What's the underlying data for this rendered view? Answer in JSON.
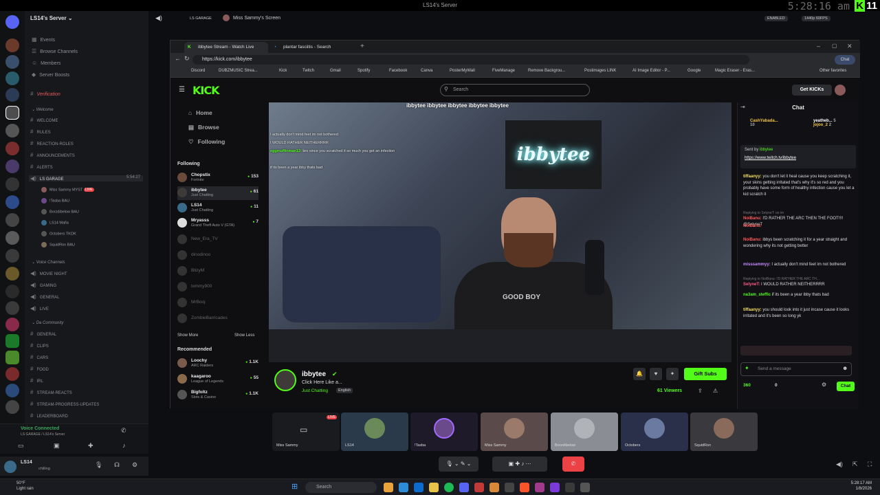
{
  "os": {
    "title": "LS14's Server",
    "clock_overlay": "5:28:16 am",
    "k_badge": "K",
    "k_number": "11",
    "enabled": "ENABLED",
    "resolution": "1440p 60FPS"
  },
  "discord": {
    "server_name": "LS14's Server",
    "menu": [
      "Events",
      "Browse Channels",
      "Members",
      "Server Boosts"
    ],
    "verification": "Verification",
    "welcome_category": "Welcome",
    "text_channels": [
      "WELCOME",
      "RULES",
      "REACTION-ROLES",
      "ANNOUNCEMENTS",
      "ALERTS"
    ],
    "garage_channel": "LS GARAGE",
    "garage_time": "5:54:27",
    "garage_members": [
      {
        "name": "Miss Sammy",
        "tag": "MYST",
        "live": "LIVE"
      },
      {
        "name": "!Tasba",
        "tag": "BAU"
      },
      {
        "name": "Borzdibelow",
        "tag": "BAU"
      },
      {
        "name": "LS14",
        "tag": "Mafia"
      },
      {
        "name": "Octobers",
        "tag": "TKOK"
      },
      {
        "name": "SquidRon",
        "tag": "BAU"
      }
    ],
    "voice_category": "Voice Channels",
    "voice_channels": [
      "MOVIE NIGHT",
      "GAMING",
      "GENERAL",
      "LIVE"
    ],
    "community_category": "Da Community",
    "community_channels": [
      "GENERAL",
      "CLIPS",
      "CARS",
      "FOOD",
      "IRL",
      "STREAM-REACTS",
      "STREAM-PROGRESS-UPDATES",
      "LEADERBOARD"
    ],
    "voice_connected": "Voice Connected",
    "voice_location": "LS GARAGE / LS14's Server",
    "user_name": "LS14",
    "user_status": "chilling",
    "stream_header": {
      "channel": "LS GARAGE",
      "screen_label": "Miss Sammy's Screen"
    }
  },
  "browser": {
    "tabs": [
      "ibbytee Stream - Watch Live",
      "plantar fasciitis - Search"
    ],
    "url": "https://kick.com/ibbytee",
    "bookmarks": [
      "Discord",
      "DUBZMUSIC Strea...",
      "Kick",
      "Twitch",
      "Gmail",
      "Spotify",
      "Facebook",
      "Canva",
      "PosterMyWall",
      "FiveManage",
      "Remove Backgrou...",
      "Postimages LINK",
      "AI Image Editor - P...",
      "Google",
      "Magic Eraser - Eras..."
    ],
    "other_bookmarks": "Other favorites",
    "chat_button": "Chat"
  },
  "kick": {
    "search_placeholder": "Search",
    "get_kicks": "Get KICKs",
    "nav": [
      "Home",
      "Browse",
      "Following"
    ],
    "following_label": "Following",
    "following": [
      {
        "name": "Chopstix",
        "game": "Fortnite",
        "count": "153"
      },
      {
        "name": "ibbytee",
        "game": "Just Chatting",
        "count": "61"
      },
      {
        "name": "LS14",
        "game": "Just Chatting",
        "count": "11"
      },
      {
        "name": "Mryasss",
        "game": "Grand Theft Auto V (GTA)",
        "count": "7"
      }
    ],
    "offline": [
      "New_Era_TV",
      "dinodinoo",
      "BlizyM",
      "tommy900",
      "MrBooj",
      "ZombieBarricades"
    ],
    "show_more": "Show More",
    "show_less": "Show Less",
    "recommended_label": "Recommended",
    "recommended": [
      {
        "name": "Loochy",
        "game": "ARC Raiders",
        "count": "1.1K"
      },
      {
        "name": "kaagaroo",
        "game": "League of Legends",
        "count": "55"
      },
      {
        "name": "Bigfoltz",
        "game": "Slots & Casino",
        "count": "1.1K"
      }
    ],
    "stream": {
      "socials": "ibbytee ibbytee ibbytee ibbytee ibbytee",
      "neon": "ibbytee",
      "shirt": "GOOD BOY",
      "overlay_chat": [
        {
          "user": "",
          "text": "I actually don't mind feet im not bothered"
        },
        {
          "user": "",
          "text": "I WOULD RATHER NEITHERRRR"
        },
        {
          "user": "eggmuffinman12:",
          "text": "bro since you scratched it so much you got an infection"
        },
        {
          "user": "",
          "text": "if its been a year ibby thats bad"
        }
      ],
      "name": "ibbytee",
      "title": "Click Here Like a...",
      "category": "Just Chatting",
      "language": "English",
      "gift_subs": "Gift Subs",
      "viewers": "61 Viewers"
    },
    "chat": {
      "title": "Chat",
      "top_gifters": [
        {
          "name": "CashYabada...",
          "count": "10"
        },
        {
          "name": "yeatheb...",
          "count": "5"
        },
        {
          "name": "jojoo_2",
          "count": "2"
        }
      ],
      "pinned_by": "Sent by",
      "pinned_user": "ibbytee",
      "pinned_link": "https://www.twitch.tv/ibbytee",
      "messages": [
        {
          "reply": "",
          "user": "tiffaanyy:",
          "color": "#f5e05a",
          "text": "you don't let it heal cause you keep scratching it, your skins getting irritated that's why it's so red and you probably have some form of healthy infection cause you let a kid scratch it"
        },
        {
          "reply": "Replying to SelyneT: oo im",
          "user": "NoiBanu:",
          "color": "#ff5b5b",
          "text": "I'D RATHER THE ARC THEN THE FOOT!!!! @SelyneT"
        },
        {
          "reply": "",
          "user": "NoiBanu:",
          "color": "#ff5b5b",
          "text": ""
        },
        {
          "reply": "",
          "user": "NoiBanu:",
          "color": "#ff5b5b",
          "text": "ibbys been scratching it for a year straight and wondering why its not getting better"
        },
        {
          "reply": "",
          "user": "misssammyy:",
          "color": "#c98bff",
          "text": "I actually don't mind feet im not bothered"
        },
        {
          "reply": "Replying to NoiBanu: I'D RATHER THE ARC TH...",
          "user": "SelyneT:",
          "color": "#ff5b8a",
          "text": "I WOULD RATHER NEITHERRRR"
        },
        {
          "reply": "",
          "user": "na3am_steffic",
          "color": "#53fc18",
          "text": "if its been a year ibby thats bad"
        },
        {
          "reply": "",
          "user": "tiffaanyy:",
          "color": "#f5e05a",
          "text": "you should look into it just incase cause it looks irritated and it's been so long yk"
        }
      ],
      "input_placeholder": "Send a message",
      "points": "360",
      "zero": "0",
      "send": "Chat"
    }
  },
  "tiles": [
    "Miss Sammy",
    "LS14",
    "!Tasba",
    "Miss Sammy",
    "Borzdibelow",
    "Octobers",
    "SquidRon"
  ],
  "tile_live": "LIVE",
  "taskbar": {
    "search": "Search",
    "temp": "50°F",
    "weather": "Light rain",
    "time": "5:28:17 AM",
    "date": "1/8/2026"
  }
}
